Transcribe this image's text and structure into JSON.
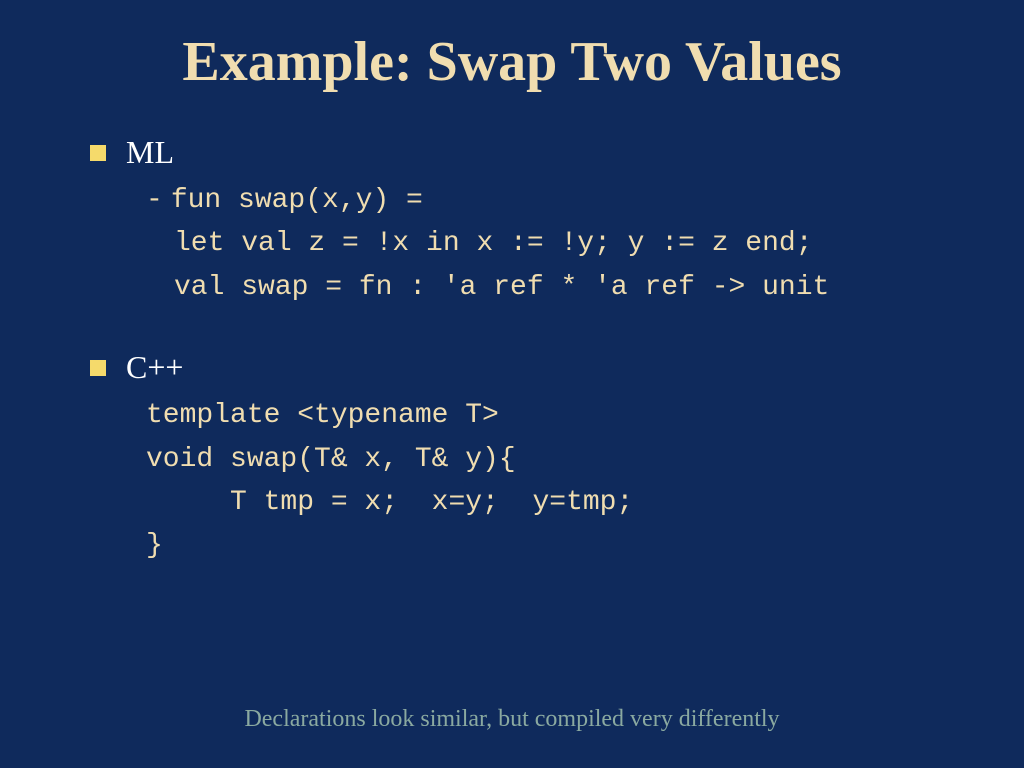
{
  "title": "Example: Swap Two Values",
  "sections": [
    {
      "label": "ML",
      "dash_line": "fun swap(x,y) =",
      "code_lines": [
        "let val z = !x in x := !y; y := z end;",
        "val swap = fn : 'a ref * 'a ref -> unit"
      ]
    },
    {
      "label": "C++",
      "dash_line": null,
      "code_lines": [
        "template <typename T>",
        "void swap(T& x, T& y){",
        "     T tmp = x;  x=y;  y=tmp;",
        "}"
      ]
    }
  ],
  "footer": "Declarations look similar, but compiled very differently"
}
